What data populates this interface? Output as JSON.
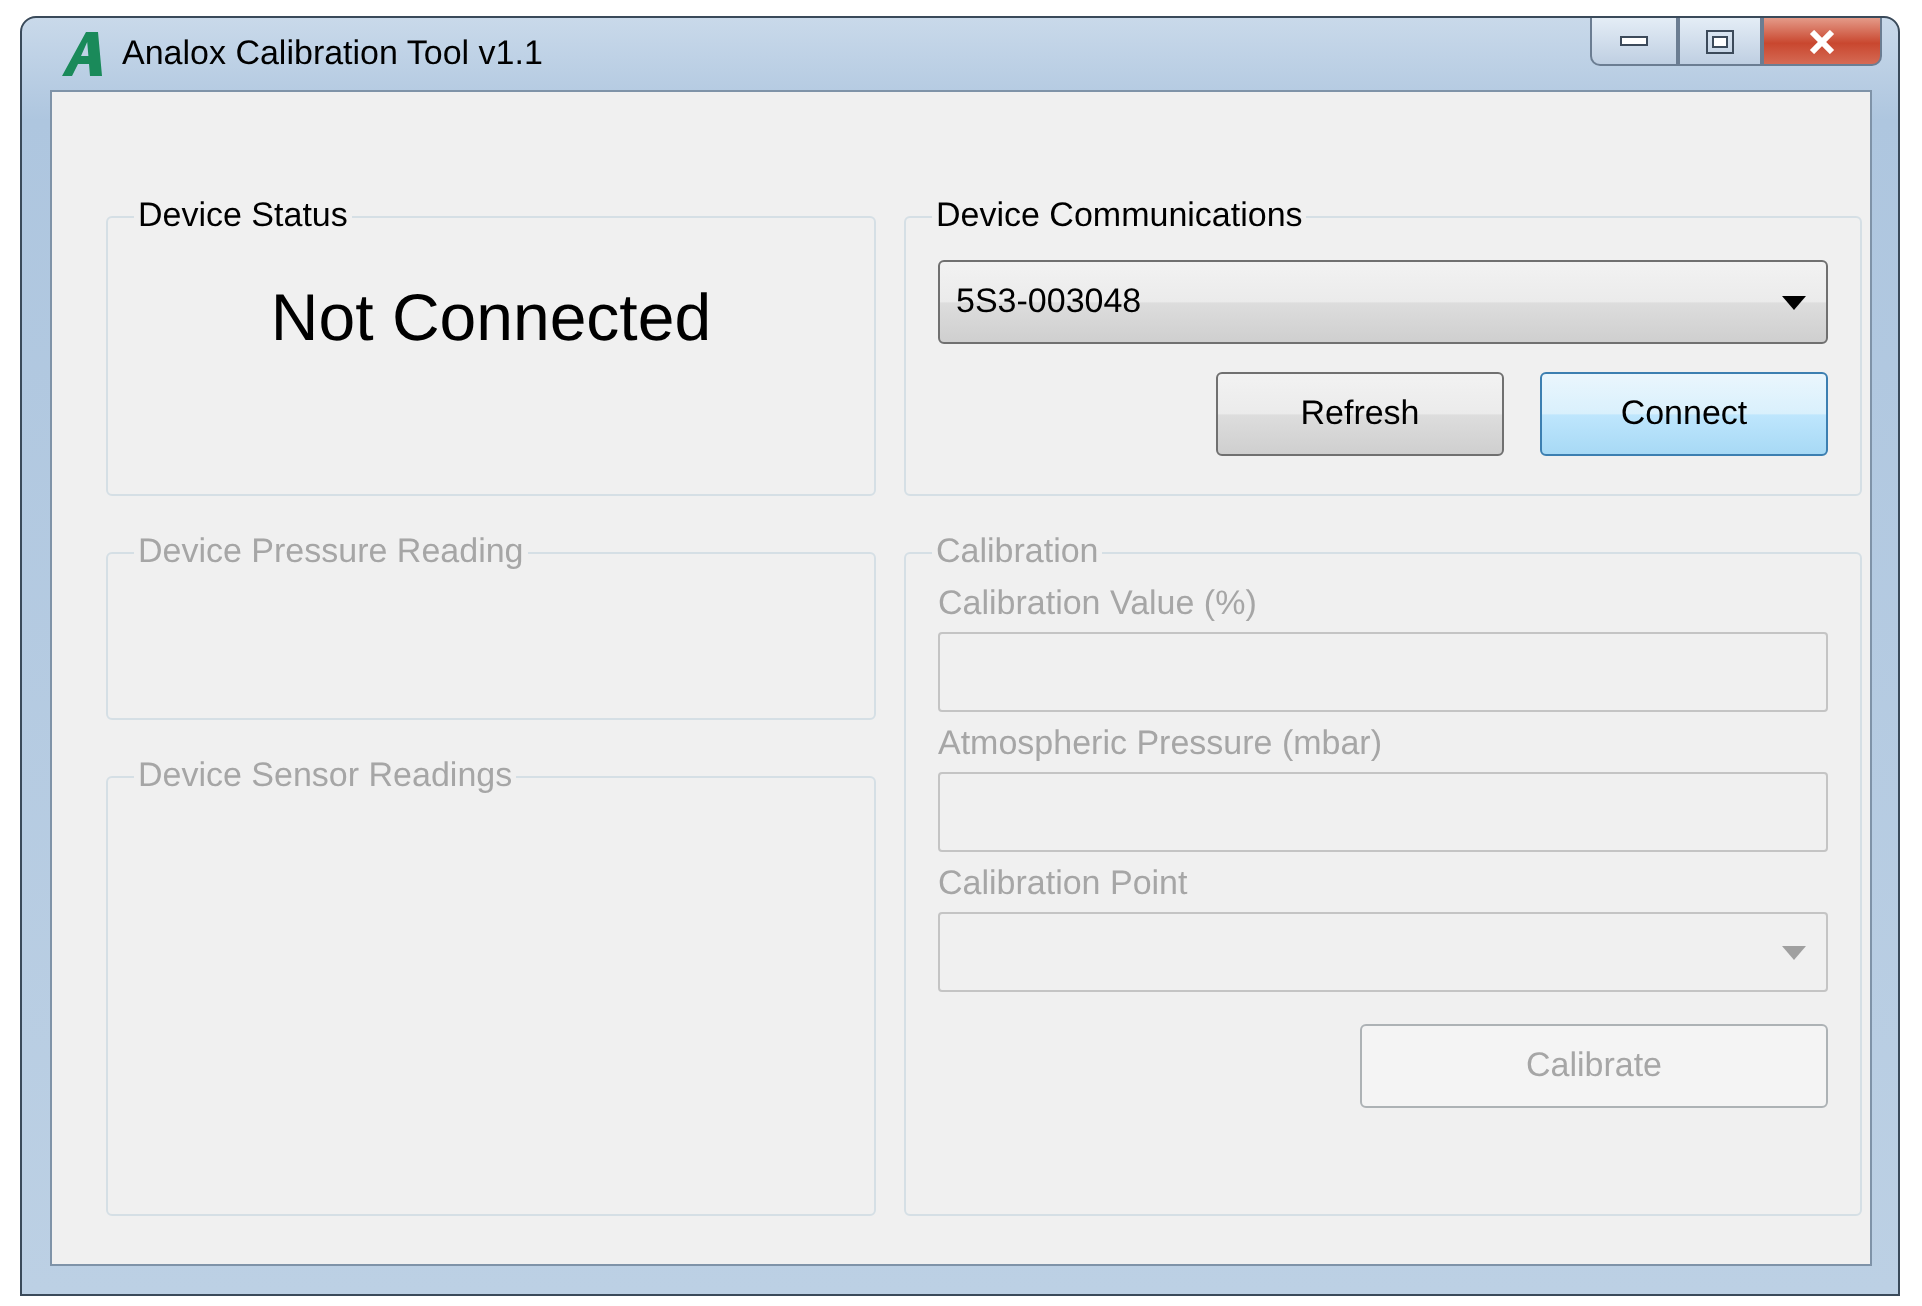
{
  "window": {
    "title": "Analox Calibration Tool v1.1"
  },
  "device_status": {
    "title": "Device Status",
    "disabled": false,
    "status": "Not Connected"
  },
  "device_communications": {
    "title": "Device Communications",
    "disabled": false,
    "device_select": {
      "value": "5S3-003048"
    },
    "buttons": [
      {
        "label": "Refresh",
        "highlighted": false
      },
      {
        "label": "Connect",
        "highlighted": true
      }
    ]
  },
  "device_pressure_reading": {
    "title": "Device Pressure Reading",
    "disabled": true
  },
  "device_sensor_readings": {
    "title": "Device Sensor Readings",
    "disabled": true
  },
  "calibration": {
    "title": "Calibration",
    "disabled": true,
    "fields": [
      {
        "kind": "text",
        "label": "Calibration Value (%)"
      },
      {
        "kind": "text",
        "label": "Atmospheric Pressure (mbar)"
      },
      {
        "kind": "dropdown",
        "label": "Calibration Point"
      }
    ],
    "button": {
      "label": "Calibrate"
    }
  }
}
